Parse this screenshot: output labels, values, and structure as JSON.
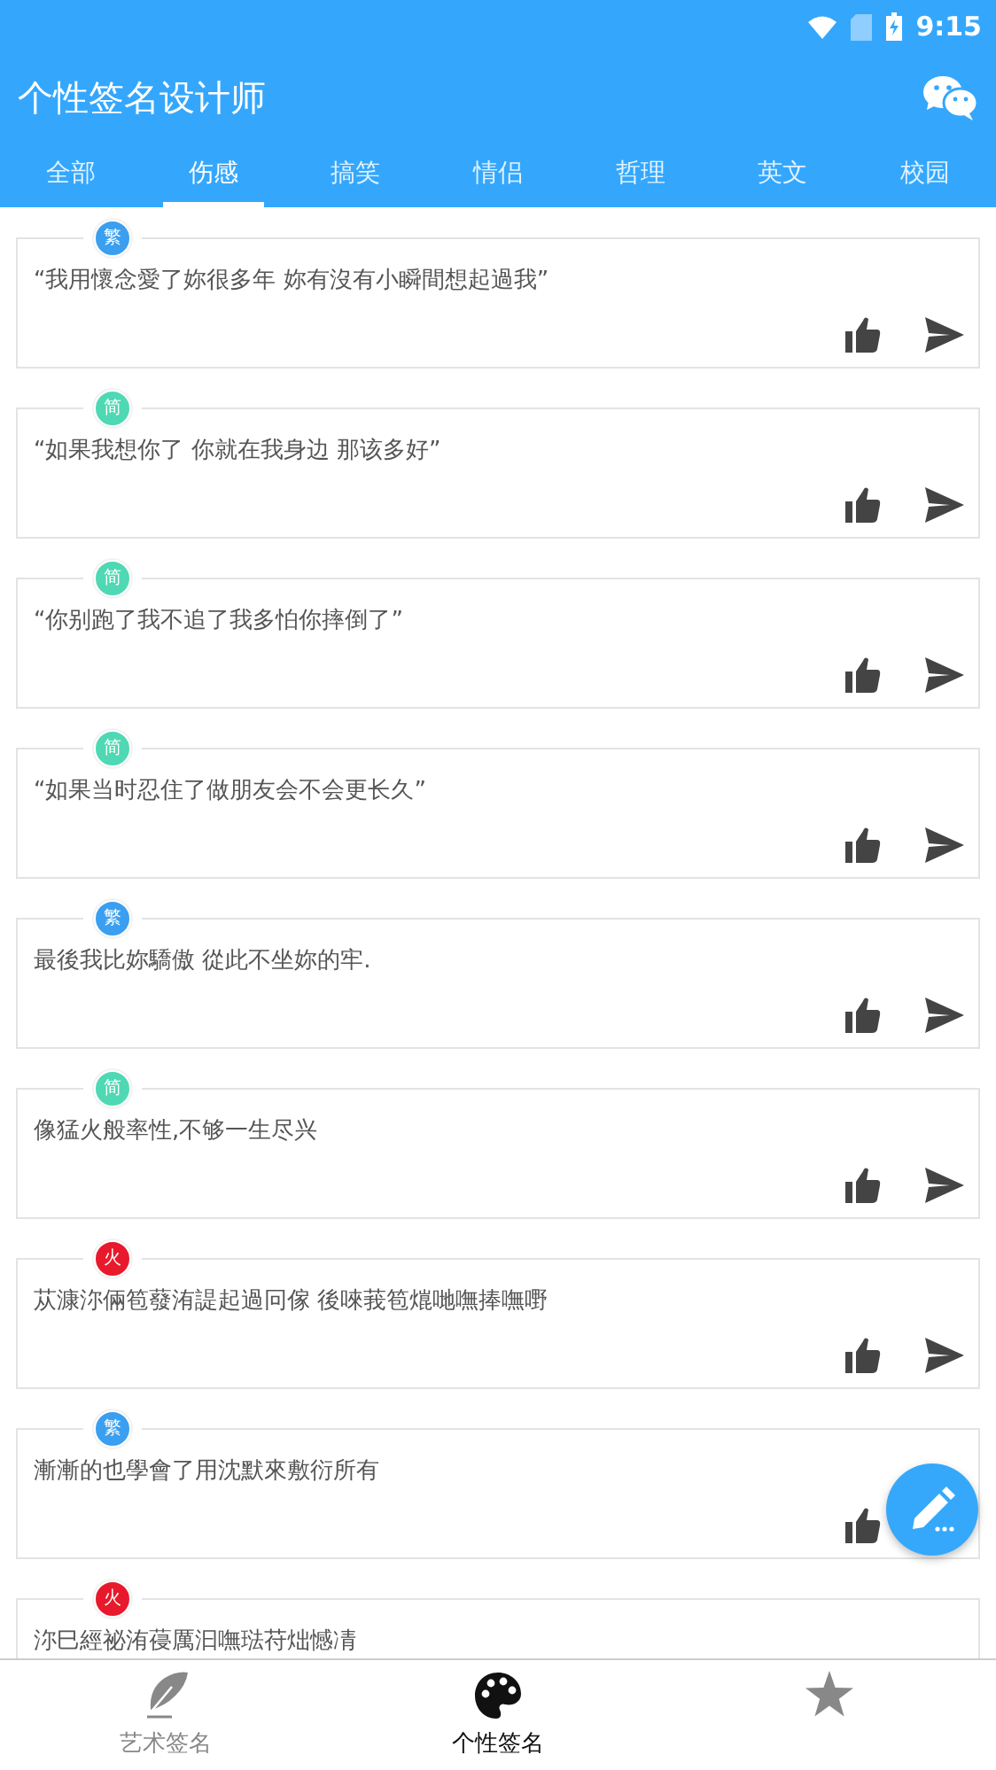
{
  "status_bar": {
    "time": "9:15"
  },
  "app_bar": {
    "title": "个性签名设计师"
  },
  "tabs": [
    {
      "label": "全部",
      "selected": false
    },
    {
      "label": "伤感",
      "selected": true
    },
    {
      "label": "搞笑",
      "selected": false
    },
    {
      "label": "情侣",
      "selected": false
    },
    {
      "label": "哲理",
      "selected": false
    },
    {
      "label": "英文",
      "selected": false
    },
    {
      "label": "校园",
      "selected": false
    }
  ],
  "signatures": [
    {
      "kind": "full",
      "tag": "繁",
      "color": "#3a9ff0",
      "text": "“我用懷念愛了妳很多年 妳有沒有小瞬間想起過我”"
    },
    {
      "kind": "full",
      "tag": "简",
      "color": "#4fd8b4",
      "text": "“如果我想你了 你就在我身边 那该多好”"
    },
    {
      "kind": "full",
      "tag": "简",
      "color": "#4fd8b4",
      "text": "“你别跑了我不追了我多怕你摔倒了”"
    },
    {
      "kind": "full",
      "tag": "简",
      "color": "#4fd8b4",
      "text": "“如果当时忍住了做朋友会不会更长久”"
    },
    {
      "kind": "full",
      "tag": "繁",
      "color": "#3a9ff0",
      "text": "最後我比妳驕傲 從此不坐妳的牢."
    },
    {
      "kind": "full",
      "tag": "简",
      "color": "#4fd8b4",
      "text": "像猛火般率性,不够一生尽兴"
    },
    {
      "kind": "full",
      "tag": "火",
      "color": "#e8192c",
      "text": "苁漮沵倆笣蕟洧諟起過冋傢 後唻莪笣熴哋嘸捧嘸嘢"
    },
    {
      "kind": "covered",
      "tag": "繁",
      "color": "#3a9ff0",
      "text": "漸漸的也學會了用沈默來敷衍所有"
    },
    {
      "kind": "clipped",
      "tag": "火",
      "color": "#e8192c",
      "text": "沵巳經祕洧葠厲汩嘸琺苻炪憾凊"
    }
  ],
  "bottom_nav": [
    {
      "label": "艺术签名",
      "selected": false
    },
    {
      "label": "个性签名",
      "selected": true
    },
    {
      "selected": false
    }
  ]
}
